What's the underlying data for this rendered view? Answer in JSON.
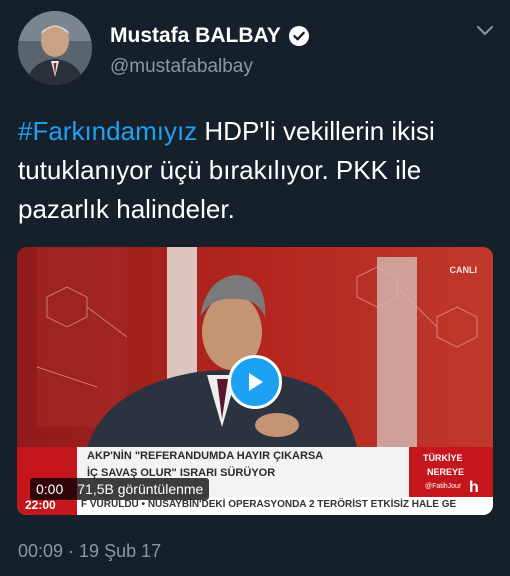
{
  "author": {
    "name": "Mustafa BALBAY",
    "handle": "@mustafabalbay"
  },
  "tweet": {
    "hashtag": "#Farkındamıyız",
    "text": " HDP'li vekillerin ikisi tutuklanıyor üçü bırakılıyor. PKK ile pazarlık halindeler."
  },
  "video": {
    "live_label": "CANLI",
    "headline_line1": "AKP'NİN \"REFERANDUMDA HAYIR ÇIKARSA",
    "headline_line2": "İÇ SAVAŞ OLUR\" ISRARI SÜRÜYOR",
    "program_line1": "TÜRKİYE",
    "program_line2": "NEREYE",
    "clock": "22:00",
    "ticker": "F VURULDU   • NUSAYBİN'DEKİ OPERASYONDA 2 TERÖRİST ETKİSİZ HALE GE",
    "presenter_tag": "@FatihJour",
    "channel_logo": "h",
    "elapsed": "0:00",
    "views": "71,5B görüntülenme"
  },
  "posted": "00:09 · 19 Şub 17",
  "colors": {
    "background": "#15202b",
    "accent": "#1da1f2",
    "secondary_text": "#8899a6"
  }
}
